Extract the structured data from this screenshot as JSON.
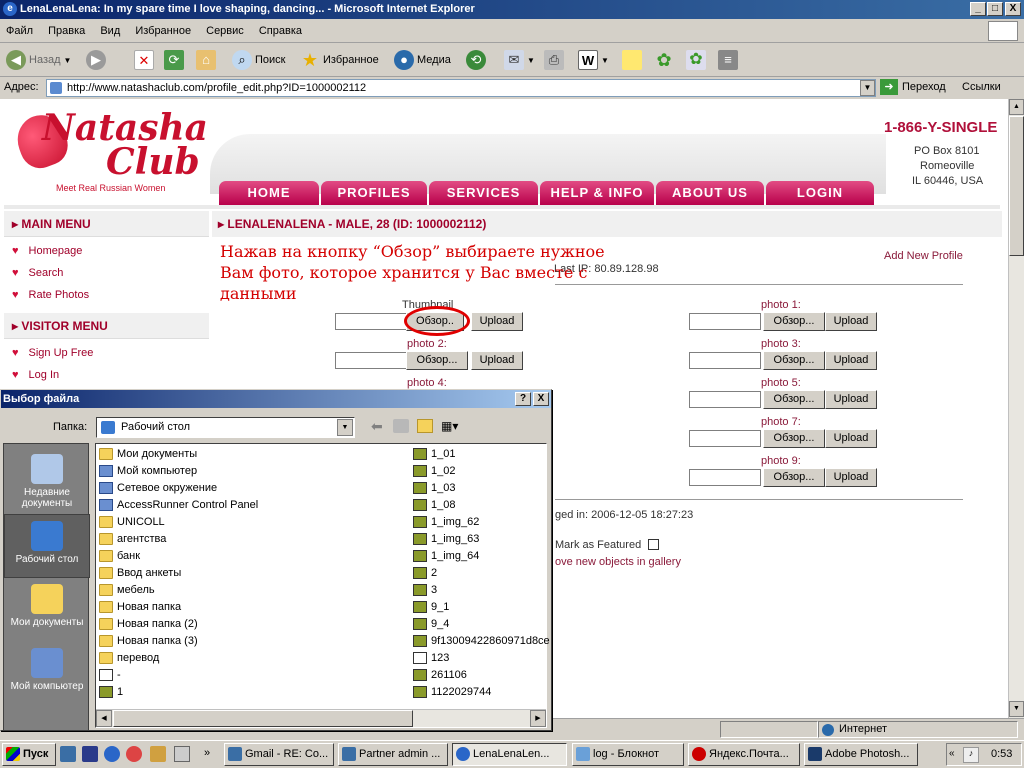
{
  "window": {
    "title": "LenaLenaLena: In my spare time I love shaping, dancing... - Microsoft Internet Explorer",
    "min": "_",
    "max": "□",
    "close": "X"
  },
  "menu": [
    "Файл",
    "Правка",
    "Вид",
    "Избранное",
    "Сервис",
    "Справка"
  ],
  "toolbar": {
    "back": "Назад",
    "search": "Поиск",
    "favorites": "Избранное",
    "media": "Медиа"
  },
  "address": {
    "label": "Адрес:",
    "url": "http://www.natashaclub.com/profile_edit.php?ID=1000002112",
    "go": "Переход",
    "links": "Ссылки"
  },
  "site": {
    "logo_top": "Natasha",
    "logo_bottom": "Club",
    "tagline": "Meet Real Russian Women",
    "phone": "1-866-Y-SINGLE",
    "address_lines": [
      "PO Box 8101",
      "Romeoville",
      "IL 60446, USA"
    ],
    "nav": [
      "HOME",
      "PROFILES",
      "SERVICES",
      "HELP & INFO",
      "ABOUT US",
      "LOGIN"
    ],
    "main_menu": {
      "title": "MAIN MENU",
      "items": [
        "Homepage",
        "Search",
        "Rate Photos"
      ]
    },
    "visitor_menu": {
      "title": "VISITOR MENU",
      "items": [
        "Sign Up Free",
        "Log In"
      ]
    },
    "profile_title": "LENALENALENA - MALE, 28 (ID: 1000002112)",
    "annotation": "Нажав на кнопку “Обзор” выбираете нужное Вам фото, которое хранится у Вас вместе с данными",
    "add_new_profile": "Add New Profile",
    "last_ip": "Last IP: 80.89.128.98",
    "thumbnail_label": "Thumbnail",
    "browse": "Обзор...",
    "browse_short": "Обзор..",
    "upload": "Upload",
    "photos": [
      {
        "label": "photo 1:"
      },
      {
        "label": "photo 2:"
      },
      {
        "label": "photo 3:"
      },
      {
        "label": "photo 4:"
      },
      {
        "label": "photo 5:"
      },
      {
        "label": "photo 7:"
      },
      {
        "label": "photo 9:"
      }
    ],
    "logged_in": "ged in: 2006-12-05 18:27:23",
    "featured": "Mark as Featured",
    "move_objects": "ove new objects in gallery"
  },
  "dialog": {
    "title": "Выбор файла",
    "help": "?",
    "close": "X",
    "folder_label": "Папка:",
    "folder_value": "Рабочий стол",
    "places": [
      "Недавние документы",
      "Рабочий стол",
      "Мои документы",
      "Мой компьютер"
    ],
    "files_col1": [
      {
        "name": "Мои документы",
        "type": "folder"
      },
      {
        "name": "Мой компьютер",
        "type": "sys"
      },
      {
        "name": "Сетевое окружение",
        "type": "sys"
      },
      {
        "name": "AccessRunner Control Panel",
        "type": "sys"
      },
      {
        "name": "UNICOLL",
        "type": "folder"
      },
      {
        "name": "агентства",
        "type": "folder"
      },
      {
        "name": "банк",
        "type": "folder"
      },
      {
        "name": "Ввод анкеты",
        "type": "folder"
      },
      {
        "name": "мебель",
        "type": "folder"
      },
      {
        "name": "Новая папка",
        "type": "folder"
      },
      {
        "name": "Новая папка (2)",
        "type": "folder"
      },
      {
        "name": "Новая папка (3)",
        "type": "folder"
      },
      {
        "name": "перевод",
        "type": "folder"
      },
      {
        "name": "-",
        "type": "doc"
      },
      {
        "name": "1",
        "type": "img"
      }
    ],
    "files_col2": [
      {
        "name": "1_01",
        "type": "img"
      },
      {
        "name": "1_02",
        "type": "img"
      },
      {
        "name": "1_03",
        "type": "img"
      },
      {
        "name": "1_08",
        "type": "img"
      },
      {
        "name": "1_img_62",
        "type": "img"
      },
      {
        "name": "1_img_63",
        "type": "img"
      },
      {
        "name": "1_img_64",
        "type": "img"
      },
      {
        "name": "2",
        "type": "img"
      },
      {
        "name": "3",
        "type": "img"
      },
      {
        "name": "9_1",
        "type": "img"
      },
      {
        "name": "9_4",
        "type": "img"
      },
      {
        "name": "9f13009422860971d8ce",
        "type": "img"
      },
      {
        "name": "123",
        "type": "doc"
      },
      {
        "name": "261106",
        "type": "img"
      },
      {
        "name": "1122029744",
        "type": "img"
      }
    ]
  },
  "status": {
    "zone": "Интернет"
  },
  "taskbar": {
    "start": "Пуск",
    "tasks": [
      {
        "label": "Gmail - RE: Co...",
        "active": false
      },
      {
        "label": "Partner admin ...",
        "active": false
      },
      {
        "label": "LenaLenaLen...",
        "active": true
      },
      {
        "label": "log - Блокнот",
        "active": false
      },
      {
        "label": "Яндекс.Почта...",
        "active": false
      },
      {
        "label": "Adobe Photosh...",
        "active": false
      }
    ],
    "clock": "0:53"
  }
}
